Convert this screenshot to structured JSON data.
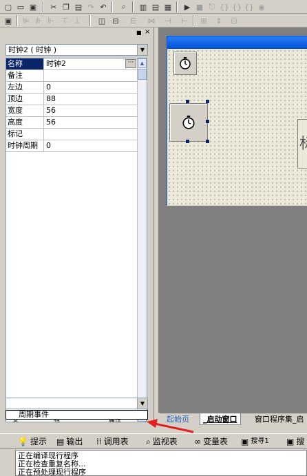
{
  "object_selector": {
    "value": "时钟2 ( 时钟 )"
  },
  "properties": [
    {
      "name": "名称",
      "value": "时钟2"
    },
    {
      "name": "备注",
      "value": ""
    },
    {
      "name": "左边",
      "value": "0"
    },
    {
      "name": "顶边",
      "value": "88"
    },
    {
      "name": "宽度",
      "value": "56"
    },
    {
      "name": "高度",
      "value": "56"
    },
    {
      "name": "标记",
      "value": ""
    },
    {
      "name": "时钟周期",
      "value": "0"
    }
  ],
  "event_selector": {
    "value": "",
    "dropdown_item": "周期事件"
  },
  "panel_tabs": {
    "support": "支",
    "program": "程",
    "property": "属性"
  },
  "form_label_partial": "标",
  "doc_tabs": [
    {
      "label": "起始页"
    },
    {
      "label": "_启动窗口"
    },
    {
      "label": "窗口程序集_启"
    }
  ],
  "output_tabs": [
    {
      "label": "提示",
      "icon": "hint-icon"
    },
    {
      "label": "输出",
      "icon": "output-icon"
    },
    {
      "label": "调用表",
      "icon": "call-table-icon"
    },
    {
      "label": "监视表",
      "icon": "watch-icon"
    },
    {
      "label": "变量表",
      "icon": "variable-icon"
    },
    {
      "label": "搜寻1",
      "icon": "search-icon"
    },
    {
      "label": "搜",
      "icon": "search-icon"
    }
  ],
  "output_log": [
    "正在编译现行程序",
    "正在检查重复名称...",
    "正在预处理现行程序"
  ],
  "colors": {
    "accent_red": "#e02020",
    "selection": "#0a246a",
    "titlebar": "#0050d8"
  }
}
